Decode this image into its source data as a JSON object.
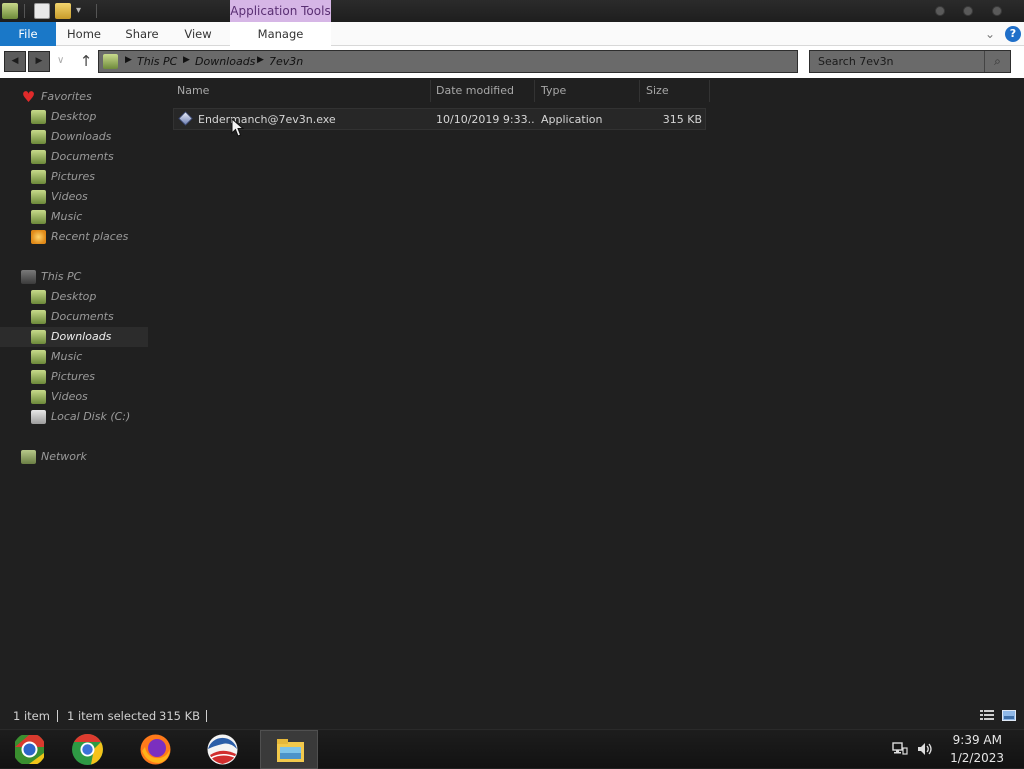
{
  "titlebar": {
    "context_tab": "Application Tools",
    "qa_dropdown_glyph": "▾"
  },
  "ribbon": {
    "tabs": [
      "File",
      "Home",
      "Share",
      "View",
      "Manage"
    ],
    "collapse_glyph": "⌄",
    "help_glyph": "?"
  },
  "address": {
    "back_glyph": "◀",
    "forward_glyph": "▶",
    "recent_glyph": "∨",
    "up_glyph": "↑",
    "crumbs": [
      "This PC",
      "Downloads",
      "7ev3n"
    ],
    "crumb_sep": "▶",
    "refresh_glyph": "↻"
  },
  "search": {
    "placeholder": "Search 7ev3n",
    "icon_glyph": "⌕"
  },
  "nav": {
    "favorites": {
      "label": "Favorites",
      "items": [
        "Desktop",
        "Downloads",
        "Documents",
        "Pictures",
        "Videos",
        "Music",
        "Recent places"
      ]
    },
    "this_pc": {
      "label": "This PC",
      "items": [
        "Desktop",
        "Documents",
        "Downloads",
        "Music",
        "Pictures",
        "Videos",
        "Local Disk (C:)"
      ]
    },
    "network": {
      "label": "Network"
    },
    "selected_item": "Downloads"
  },
  "columns": {
    "name": "Name",
    "date": "Date modified",
    "type": "Type",
    "size": "Size"
  },
  "files": [
    {
      "name": "Endermanch@7ev3n.exe",
      "date": "10/10/2019 9:33...",
      "type": "Application",
      "size": "315 KB"
    }
  ],
  "status": {
    "count": "1 item",
    "selected": "1 item selected",
    "selected_size": "315 KB"
  },
  "taskbar": {
    "apps": [
      "chromium",
      "chrome",
      "firefox",
      "obama-flag",
      "file-explorer"
    ],
    "active_app": "file-explorer",
    "time": "9:39 AM",
    "date": "1/2/2023"
  },
  "colors": {
    "accent": "#1a78c8",
    "context_tab": "#d6b6e6",
    "window_bg": "#202020"
  }
}
